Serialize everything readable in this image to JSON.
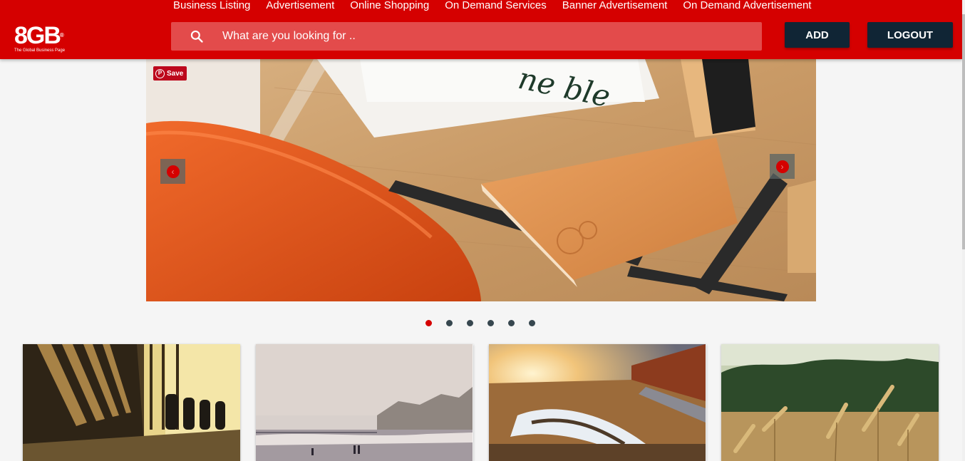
{
  "nav": {
    "items": [
      "Business Listing",
      "Advertisement",
      "Online Shopping",
      "On Demand Services",
      "Banner Advertisement",
      "On Demand Advertisement"
    ]
  },
  "logo": {
    "text": "8GB",
    "tagline": "The Global Business Page"
  },
  "search": {
    "placeholder": "What are you looking for .."
  },
  "buttons": {
    "add": "ADD",
    "logout": "LOGOUT"
  },
  "carousel": {
    "save_label": "Save",
    "slide_count": 6,
    "active_slide": 1
  },
  "colors": {
    "brand_red": "#d50000",
    "button_navy": "#102535",
    "search_bg": "#e34b4b"
  }
}
